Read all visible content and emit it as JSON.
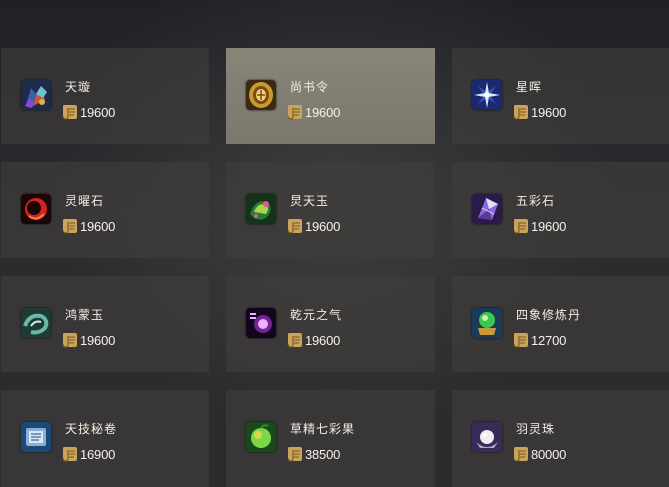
{
  "shop": {
    "items": [
      {
        "name": "天璇",
        "price": "19600",
        "icon": "gem-cluster-icon",
        "colors": [
          "#3a5fb0",
          "#c2593a",
          "#6cc0d8"
        ]
      },
      {
        "name": "尚书令",
        "price": "19600",
        "icon": "golden-token-icon",
        "colors": [
          "#c99a2e",
          "#7a4a12",
          "#f4d27a"
        ]
      },
      {
        "name": "星晖",
        "price": "19600",
        "icon": "star-burst-icon",
        "colors": [
          "#1a2a72",
          "#d9e9ff",
          "#4d6ed8"
        ]
      },
      {
        "name": "灵曜石",
        "price": "19600",
        "icon": "crimson-orb-icon",
        "colors": [
          "#1a0606",
          "#d2231b",
          "#ff7a4a"
        ]
      },
      {
        "name": "炅天玉",
        "price": "19600",
        "icon": "jade-dragon-icon",
        "colors": [
          "#2a7a3a",
          "#a8d84a",
          "#e45a8a"
        ]
      },
      {
        "name": "五彩石",
        "price": "19600",
        "icon": "prism-stone-icon",
        "colors": [
          "#2a1a4a",
          "#8a6ad8",
          "#e0e0ff"
        ]
      },
      {
        "name": "鸿蒙玉",
        "price": "19600",
        "icon": "cyan-swirl-icon",
        "colors": [
          "#1e3a34",
          "#6ab8a8",
          "#d8efe6"
        ]
      },
      {
        "name": "乾元之气",
        "price": "19600",
        "icon": "violet-qi-icon",
        "colors": [
          "#12061e",
          "#b03ad8",
          "#f0b0ff"
        ]
      },
      {
        "name": "四象修炼丹",
        "price": "12700",
        "icon": "elixir-orb-icon",
        "colors": [
          "#1a3a5a",
          "#3cc84a",
          "#c89a3a"
        ]
      },
      {
        "name": "天技秘卷",
        "price": "16900",
        "icon": "scroll-book-icon",
        "colors": [
          "#1a4a7a",
          "#8ab0d8",
          "#d8e8f4"
        ]
      },
      {
        "name": "草精七彩果",
        "price": "38500",
        "icon": "rainbow-fruit-icon",
        "colors": [
          "#1a4a1a",
          "#7ad84a",
          "#d8d84a"
        ]
      },
      {
        "name": "羽灵珠",
        "price": "80000",
        "icon": "pearl-icon",
        "colors": [
          "#3a2a5a",
          "#eeeeee",
          "#a8a8c8"
        ]
      }
    ],
    "selected_index": 1,
    "currency_icon": "scroll-currency-icon",
    "currency_color": "#d8b66a"
  }
}
